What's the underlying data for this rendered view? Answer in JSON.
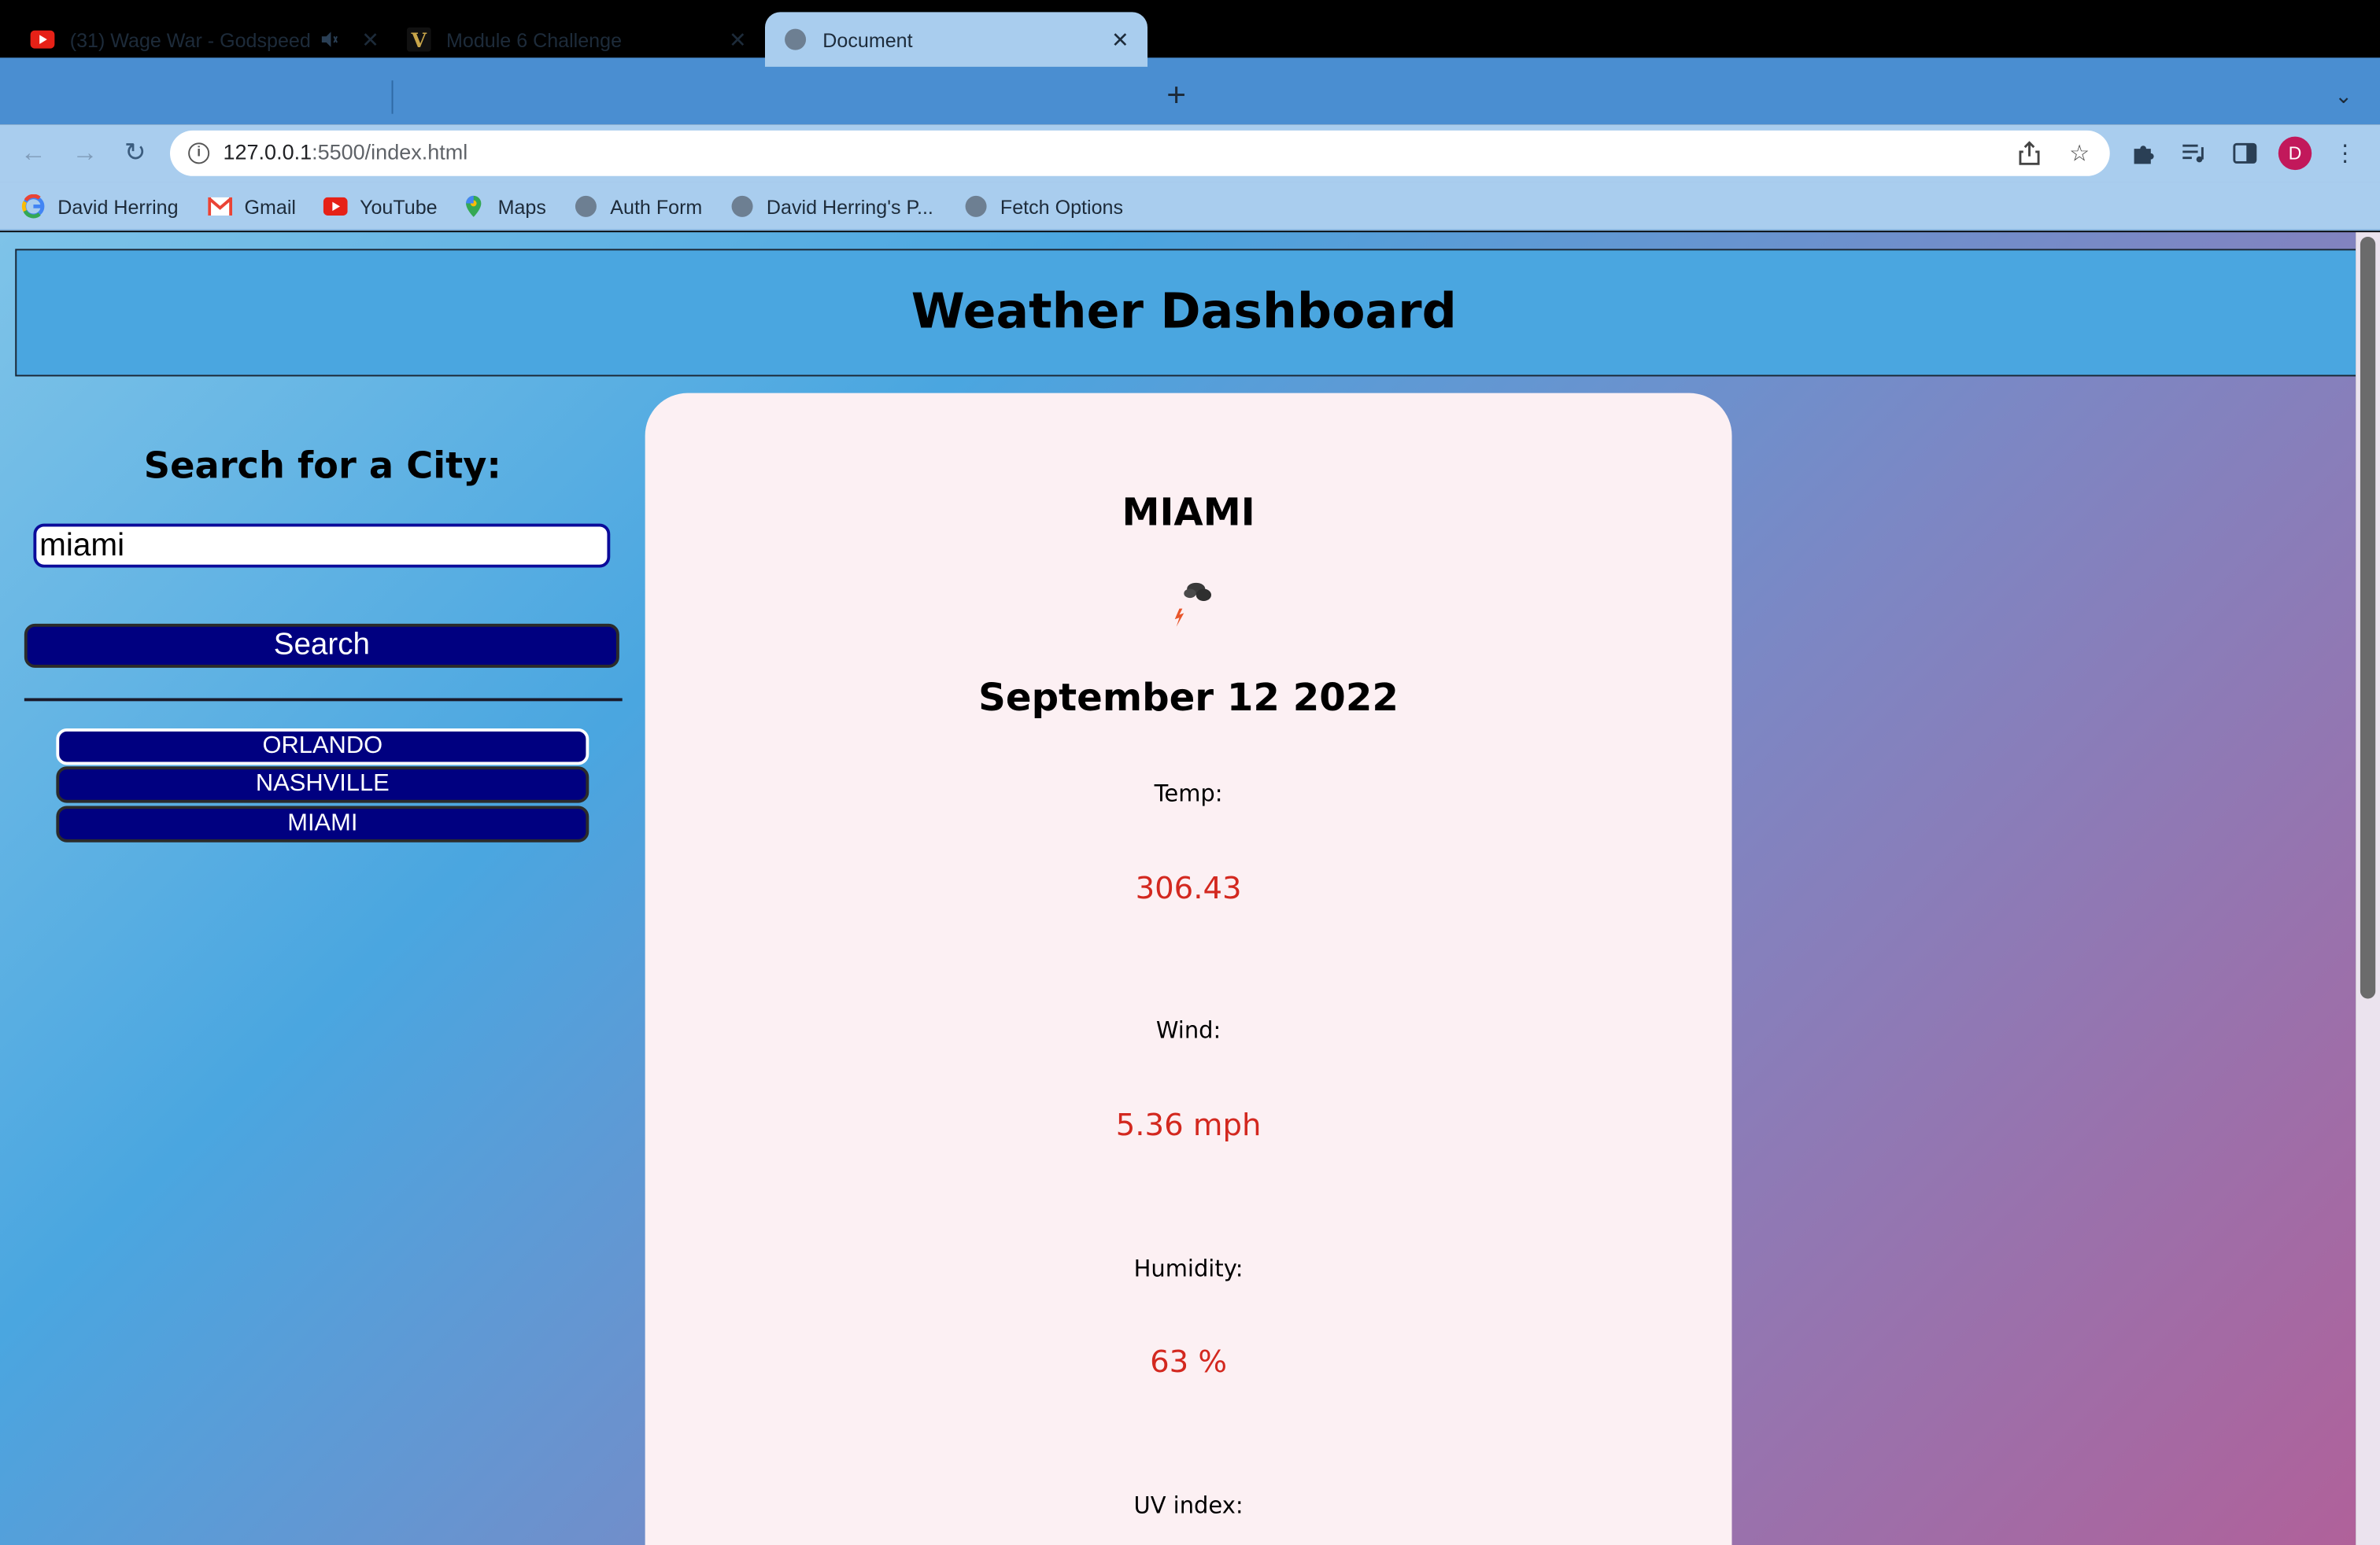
{
  "browser": {
    "tabs": [
      {
        "title": "(31) Wage War - Godspeed",
        "icon": "youtube-icon"
      },
      {
        "title": "Module 6 Challenge",
        "icon": "v-logo-icon"
      },
      {
        "title": "Document",
        "icon": "globe-icon"
      }
    ],
    "url_host": "127.0.0.1",
    "url_rest": ":5500/index.html",
    "bookmarks": [
      {
        "label": "David Herring",
        "icon": "google-icon"
      },
      {
        "label": "Gmail",
        "icon": "gmail-icon"
      },
      {
        "label": "YouTube",
        "icon": "youtube-icon"
      },
      {
        "label": "Maps",
        "icon": "maps-icon"
      },
      {
        "label": "Auth Form",
        "icon": "globe-icon"
      },
      {
        "label": "David Herring's P...",
        "icon": "globe-icon"
      },
      {
        "label": "Fetch Options",
        "icon": "globe-icon"
      }
    ],
    "profile_initial": "D"
  },
  "page": {
    "title": "Weather Dashboard",
    "search": {
      "heading": "Search for a City:",
      "value": "miami",
      "button_label": "Search"
    },
    "history": [
      "ORLANDO",
      "NASHVILLE",
      "MIAMI"
    ],
    "current": {
      "city": "MIAMI",
      "icon": "thunderstorm-icon",
      "date": "September 12 2022",
      "temp_label": "Temp:",
      "temp_value": "306.43",
      "wind_label": "Wind:",
      "wind_value": "5.36 mph",
      "humidity_label": "Humidity:",
      "humidity_value": "63 %",
      "uv_label": "UV index:"
    }
  },
  "colors": {
    "accent_button": "#000080",
    "value_text": "#d3281f",
    "header_bg": "#4aa6e0",
    "card_bg": "#fcf0f3"
  }
}
